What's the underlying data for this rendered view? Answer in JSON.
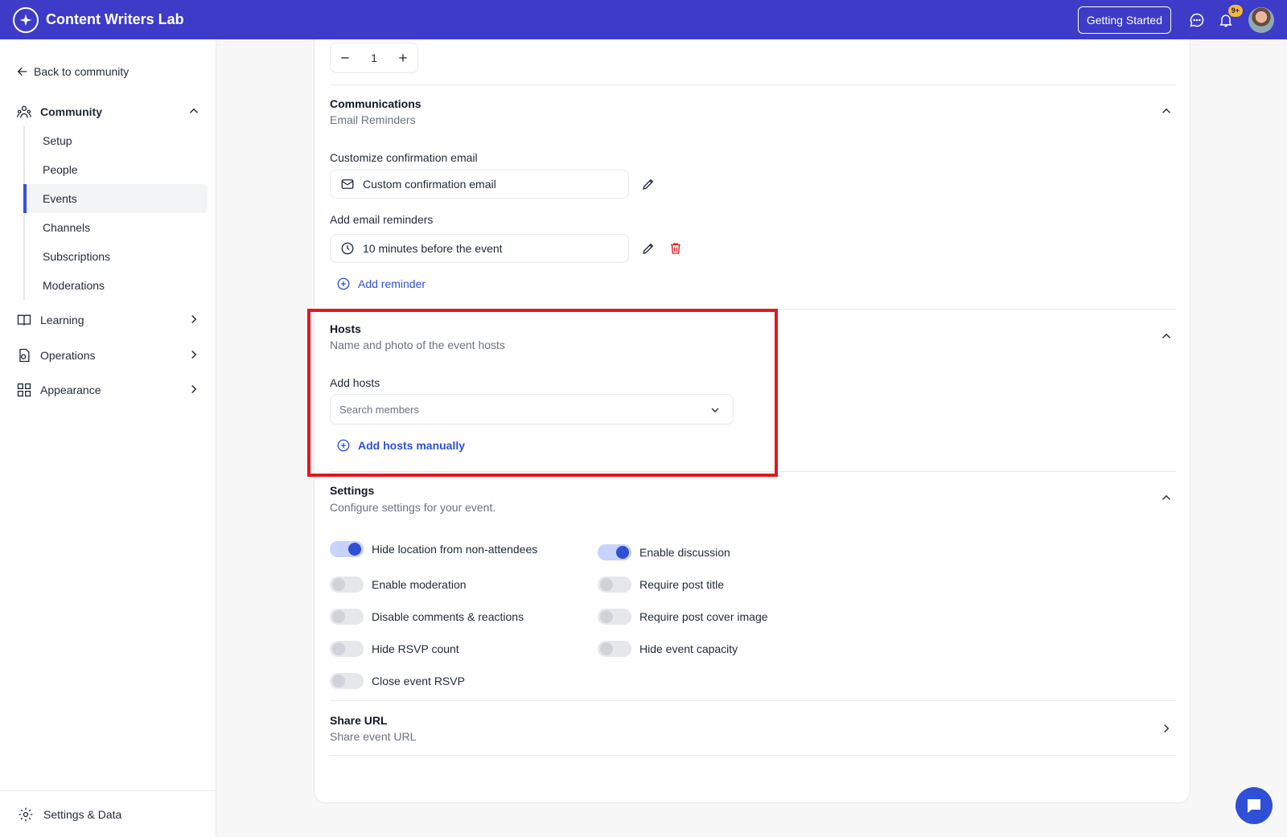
{
  "app": {
    "title": "Content Writers Lab"
  },
  "topbar": {
    "getting_started": "Getting Started",
    "notification_count": "9+"
  },
  "sidebar": {
    "back_label": "Back to community",
    "community": "Community",
    "items": [
      "Setup",
      "People",
      "Events",
      "Channels",
      "Subscriptions",
      "Moderations"
    ],
    "active_item": "Events",
    "learning": "Learning",
    "operations": "Operations",
    "appearance": "Appearance",
    "settings": "Settings & Data"
  },
  "stepper": {
    "value": "1"
  },
  "communications": {
    "title": "Communications",
    "subtitle": "Email Reminders",
    "confirm_label": "Customize confirmation email",
    "confirm_value": "Custom confirmation email",
    "reminder_label": "Add email reminders",
    "reminder_value": "10 minutes before the event",
    "add_reminder": "Add reminder"
  },
  "hosts": {
    "title": "Hosts",
    "subtitle": "Name and photo of the event hosts",
    "add_label": "Add hosts",
    "search_placeholder": "Search members",
    "add_manual": "Add hosts manually"
  },
  "settings": {
    "title": "Settings",
    "subtitle": "Configure settings for your event.",
    "left": [
      {
        "label": "Hide location from non-attendees",
        "on": true
      },
      {
        "label": "Enable moderation",
        "on": false
      },
      {
        "label": "Disable comments & reactions",
        "on": false
      },
      {
        "label": "Hide RSVP count",
        "on": false
      },
      {
        "label": "Close event RSVP",
        "on": false
      }
    ],
    "right": [
      {
        "label": "Enable discussion",
        "on": true
      },
      {
        "label": "Require post title",
        "on": false
      },
      {
        "label": "Require post cover image",
        "on": false
      },
      {
        "label": "Hide event capacity",
        "on": false
      }
    ]
  },
  "share": {
    "title": "Share URL",
    "subtitle": "Share event URL"
  },
  "colors": {
    "brand": "#3d3bc8",
    "accent": "#2f4fd6",
    "danger": "#e0181e"
  },
  "icons": [
    "sparkle-logo-icon",
    "chat-icon",
    "bell-icon",
    "arrow-left-icon",
    "community-icon",
    "book-icon",
    "operations-icon",
    "appearance-icon",
    "gear-icon",
    "mail-icon",
    "clock-icon",
    "pencil-icon",
    "trash-icon",
    "plus-circle-icon",
    "chevron-down-icon",
    "chevron-up-icon",
    "chevron-right-icon"
  ]
}
